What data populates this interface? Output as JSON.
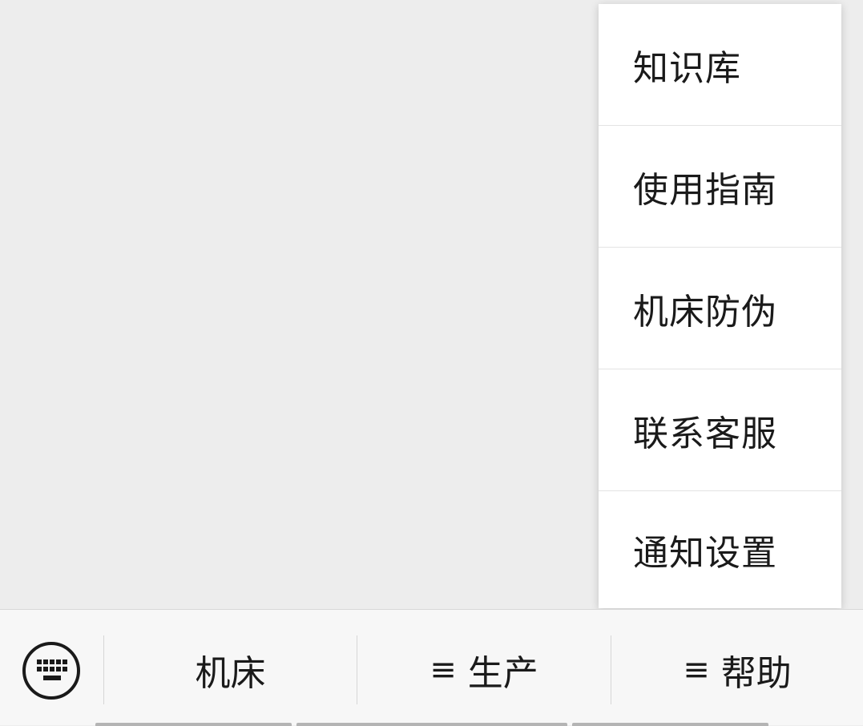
{
  "popup_menu": {
    "items": [
      {
        "label": "知识库"
      },
      {
        "label": "使用指南"
      },
      {
        "label": "机床防伪"
      },
      {
        "label": "联系客服"
      },
      {
        "label": "通知设置"
      }
    ]
  },
  "bottom_bar": {
    "keyboard_icon": "keyboard-icon",
    "menus": [
      {
        "label": "机床",
        "prefix": ""
      },
      {
        "label": "生产",
        "prefix": "≡"
      },
      {
        "label": "帮助",
        "prefix": "≡"
      }
    ]
  },
  "colors": {
    "background": "#ededed",
    "menu_background": "#ffffff",
    "bar_background": "#f7f7f7",
    "text": "#1a1a1a",
    "divider": "#e3e3e3"
  }
}
